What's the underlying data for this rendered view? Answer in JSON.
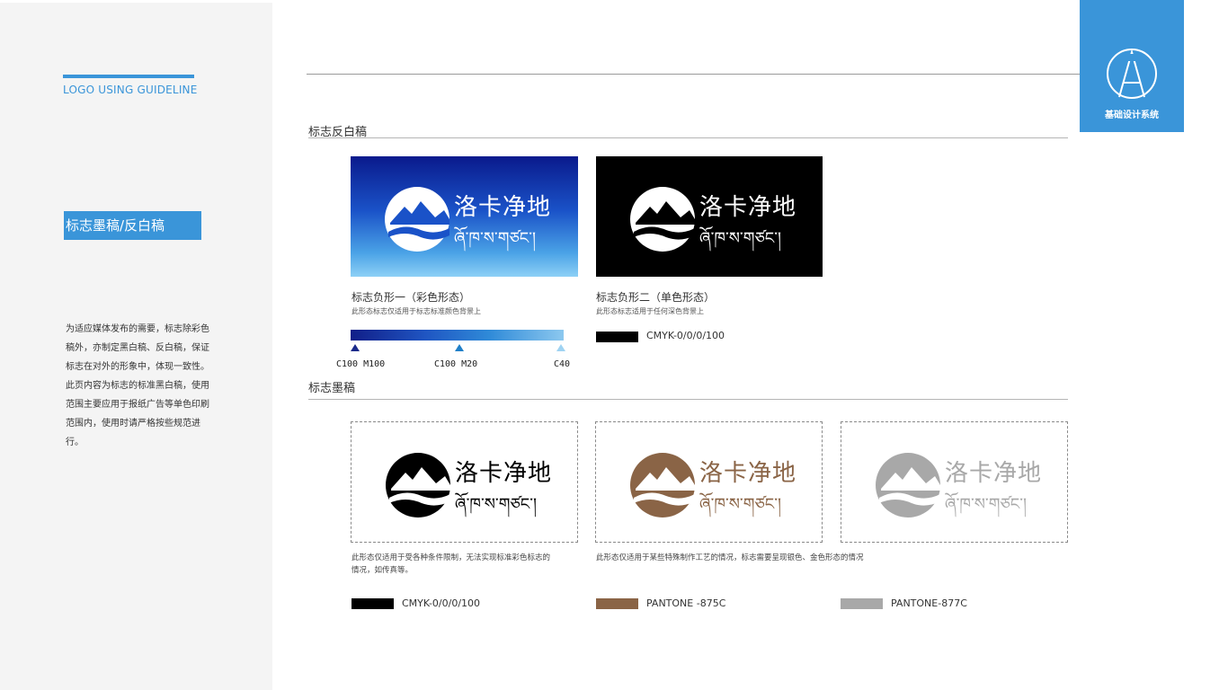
{
  "sidebar": {
    "title": "LOGO USING GUIDELINE",
    "tag": "标志墨稿/反白稿",
    "description": "为适应媒体发布的需要，标志除彩色稿外，亦制定黑白稿、反白稿，保证标志在对外的形象中，体现一致性。此页内容为标志的标准黑白稿，使用范围主要应用于报纸广告等单色印刷范围内，使用时请严格按些规范进行。"
  },
  "badge": {
    "text": "基础设计系统",
    "icon": "letter-a-circle-icon"
  },
  "logo": {
    "chinese": "洛卡净地",
    "tibetan": "ཞོ་ཁ་ས་གཙང་།"
  },
  "reverse_section": {
    "title": "标志反白稿",
    "color_version": {
      "title": "标志负形一（彩色形态）",
      "subtitle": "此形态标志仅适用于标志标准颜色背景上",
      "gradient_stops": [
        {
          "label": "C100  M100",
          "color": "#1a2a8a"
        },
        {
          "label": "C100  M20",
          "color": "#1f7fc8"
        },
        {
          "label": "C40",
          "color": "#9fd3f2"
        }
      ]
    },
    "mono_version": {
      "title": "标志负形二（单色形态）",
      "subtitle": "此形态标志适用于任何深色背景上",
      "swatch_label": "CMYK-0/0/0/100",
      "swatch_color": "#000000"
    }
  },
  "ink_section": {
    "title": "标志墨稿",
    "variants": [
      {
        "note": "此形态仅适用于受各种条件限制，无法实现标准彩色标志的情况，如传真等。",
        "swatch_label": "CMYK-0/0/0/100",
        "color": "#000000"
      },
      {
        "note": "此形态仅适用于某些特殊制作工艺的情况，标志需要呈现银色、金色形态的情况",
        "swatch_label": "PANTONE -875C",
        "color": "#8a6446"
      },
      {
        "note": "",
        "swatch_label": "PANTONE-877C",
        "color": "#a8a8a8"
      }
    ]
  },
  "colors": {
    "accent": "#3a95d9",
    "sidebar_bg": "#f4f4f4",
    "reverse_tile_bg": "#000000"
  }
}
